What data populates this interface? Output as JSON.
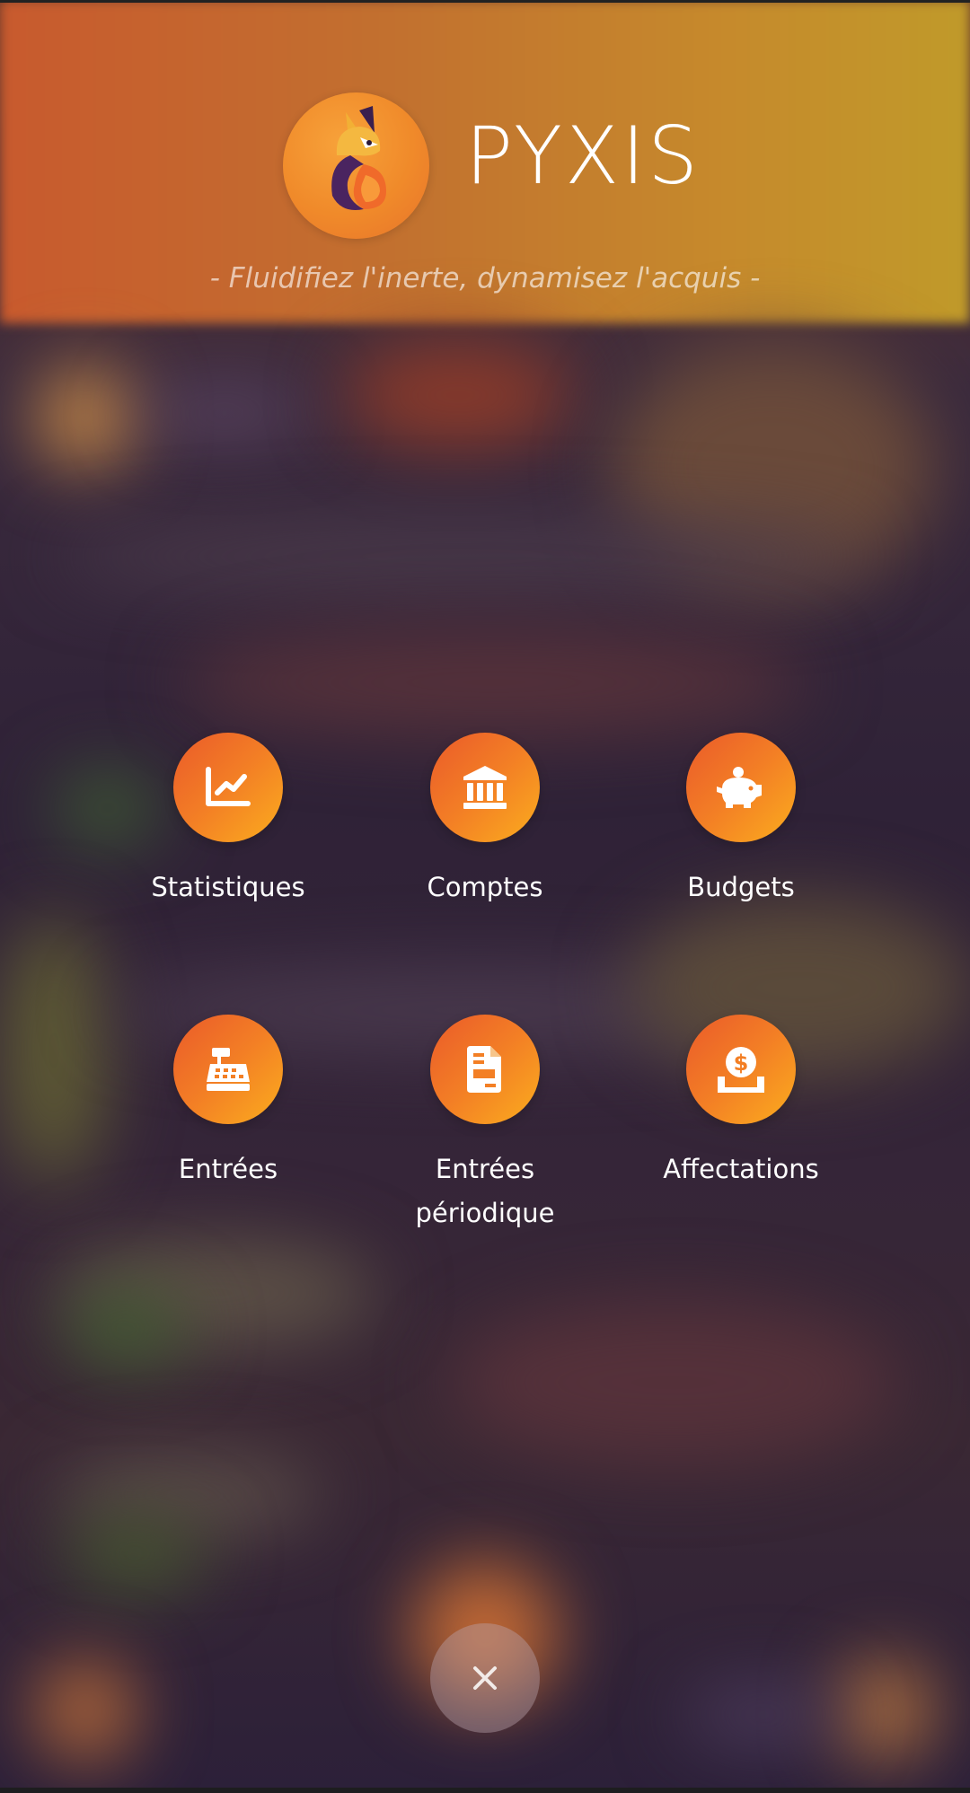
{
  "header": {
    "app_name": "PYXIS",
    "tagline": "- Fluidifiez l'inerte, dynamisez l'acquis -",
    "logo_icon": "fox-logo-icon"
  },
  "menu": {
    "items": [
      {
        "label": "Statistiques",
        "icon": "chart-line-icon"
      },
      {
        "label": "Comptes",
        "icon": "bank-icon"
      },
      {
        "label": "Budgets",
        "icon": "piggy-bank-icon"
      },
      {
        "label": "Entrées",
        "icon": "cash-register-icon"
      },
      {
        "label": "Entrées périodique",
        "icon": "file-invoice-icon"
      },
      {
        "label": "Affectations",
        "icon": "hand-dollar-icon"
      }
    ]
  },
  "close_button": {
    "icon": "close-icon"
  },
  "colors": {
    "accent_start": "#ea5a2a",
    "accent_end": "#fbad1e",
    "text": "#ffffff"
  }
}
